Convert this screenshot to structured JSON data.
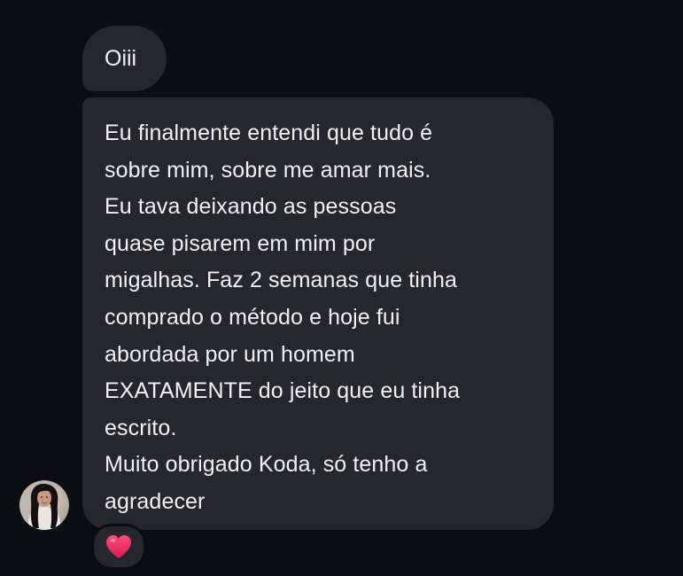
{
  "conversation": {
    "messages": [
      {
        "lines": [
          "Oiii"
        ]
      },
      {
        "lines": [
          "Eu finalmente entendi que tudo é",
          "sobre mim, sobre me amar mais.",
          "Eu tava deixando as pessoas",
          "quase pisarem em mim por",
          "migalhas. Faz 2 semanas que tinha",
          "comprado o método e hoje fui",
          "abordada por um homem",
          "EXATAMENTE do jeito que eu tinha",
          "escrito.",
          "Muito obrigado Koda, só tenho a",
          "agradecer"
        ]
      }
    ],
    "reaction": {
      "icon": "heart-icon",
      "color": "#e8265a"
    },
    "avatar": {
      "icon": "profile-photo"
    },
    "colors": {
      "background": "#0c0d11",
      "bubble": "#26272c",
      "text": "#f2f2f4"
    }
  }
}
